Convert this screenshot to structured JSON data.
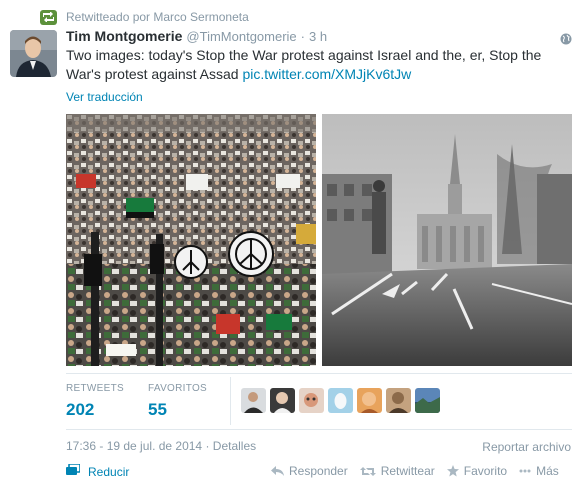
{
  "retweet_context": {
    "text": "Retwitteado por Marco Sermoneta"
  },
  "tweet": {
    "author_name": "Tim Montgomerie",
    "author_handle": "@TimMontgomerie",
    "separator": "·",
    "time_ago": "3 h",
    "text": "Two images: today's Stop the War protest against Israel and the, er, Stop the War's protest against Assad ",
    "link": "pic.twitter.com/XMJjKv6tJw",
    "translate_label": "Ver traducción",
    "timestamp": "17:36 - 19 de jul. de 2014",
    "details_sep": " · ",
    "details_label": "Detalles"
  },
  "stats": {
    "retweets_label": "RETWEETS",
    "retweets_value": "202",
    "favorites_label": "FAVORITOS",
    "favorites_value": "55"
  },
  "actions": {
    "report": "Reportar archivo",
    "collapse": "Reducir",
    "reply": "Responder",
    "retweet": "Retwittear",
    "favorite": "Favorito",
    "more": "Más"
  },
  "colors": {
    "link": "#0084b4",
    "retweet_green": "#5c913b",
    "muted": "#8899a6"
  },
  "icons": [
    "retweet-icon",
    "globe-icon",
    "reply-icon",
    "favorite-star-icon",
    "more-dots-icon",
    "collapse-icon"
  ]
}
